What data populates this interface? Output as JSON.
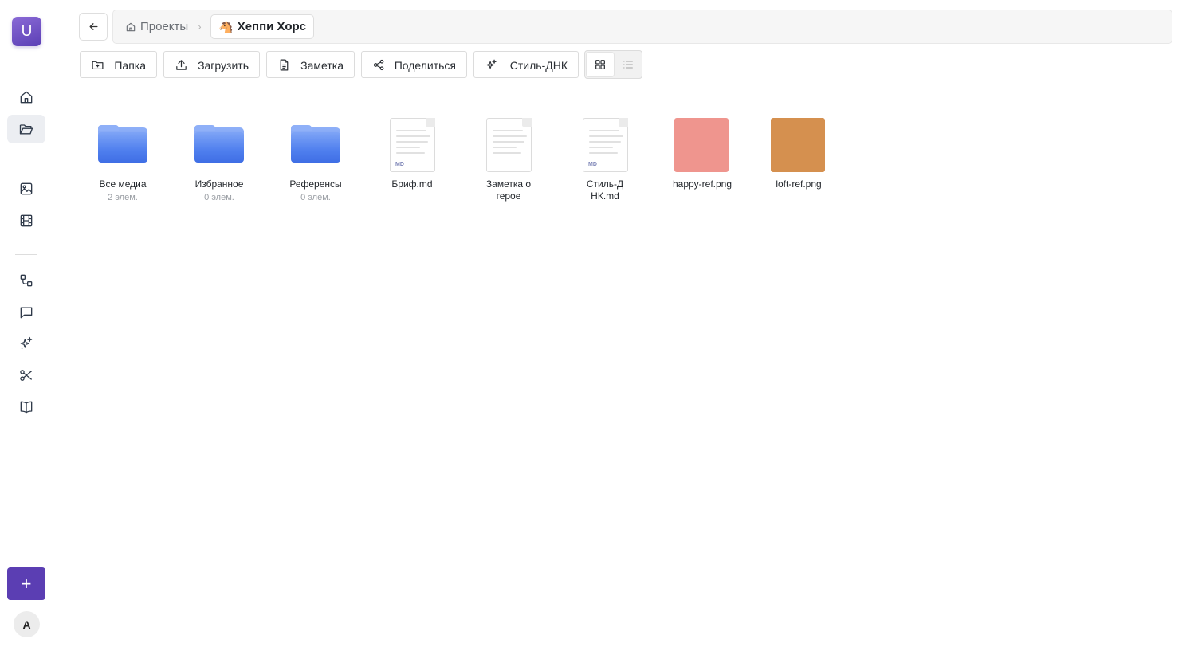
{
  "app": {
    "logo_letter": "U",
    "user_initial": "A",
    "new_label": "+"
  },
  "breadcrumb": {
    "home": "Проекты",
    "separator": "›",
    "current_emoji": "🐴",
    "current": "Хеппи Хорс"
  },
  "toolbar": {
    "folder": "Папка",
    "upload": "Загрузить",
    "note": "Заметка",
    "share": "Поделиться",
    "style_dna": "Стиль-ДНК"
  },
  "items": [
    {
      "type": "folder",
      "name": "Все медиа",
      "meta": "2 элем."
    },
    {
      "type": "folder",
      "name": "Избранное",
      "meta": "0 элем."
    },
    {
      "type": "folder",
      "name": "Референсы",
      "meta": "0 элем."
    },
    {
      "type": "markdown",
      "name": "Бриф.md",
      "badge": "MD"
    },
    {
      "type": "note",
      "name": "Заметка о герое"
    },
    {
      "type": "markdown",
      "name": "Стиль-ДНК.md",
      "badge": "MD"
    },
    {
      "type": "image",
      "name": "happy-ref.png",
      "color": "#ef958e"
    },
    {
      "type": "image",
      "name": "loft-ref.png",
      "color": "#d5904f"
    }
  ],
  "colors": {
    "accent": "#5b3eb3",
    "folder_blue": "#4f7fee"
  }
}
